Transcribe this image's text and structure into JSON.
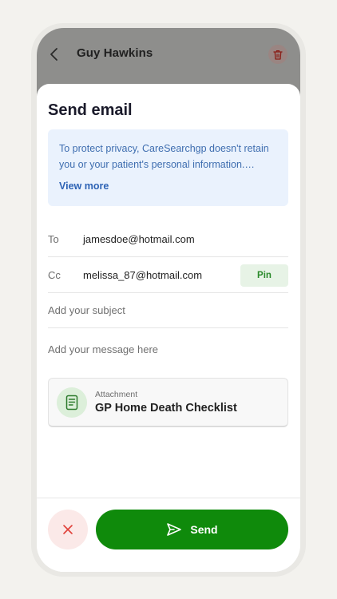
{
  "header": {
    "contact_name": "Guy Hawkins",
    "back_icon": "chevron-left",
    "delete_icon": "trash"
  },
  "sheet": {
    "title": "Send email",
    "info": {
      "text": "To protect privacy, CareSearchgp doesn't retain you or your patient's personal information. Please ensure you have your patient's consent before sending.",
      "link_label": "View more"
    },
    "to": {
      "label": "To",
      "value": "jamesdoe@hotmail.com"
    },
    "cc": {
      "label": "Cc",
      "value": "melissa_87@hotmail.com",
      "pin_label": "Pin"
    },
    "subject": {
      "placeholder": "Add your subject",
      "value": ""
    },
    "message": {
      "placeholder": "Add your message here",
      "value": ""
    },
    "attachment": {
      "caption": "Attachment",
      "name": "GP Home Death Checklist",
      "icon": "document"
    }
  },
  "footer": {
    "cancel_icon": "close",
    "send_label": "Send",
    "send_icon": "send"
  },
  "colors": {
    "primary": "#0f8a0b",
    "info_bg": "#eaf2fd",
    "info_text": "#3f6eb0",
    "danger": "#e0413a"
  }
}
